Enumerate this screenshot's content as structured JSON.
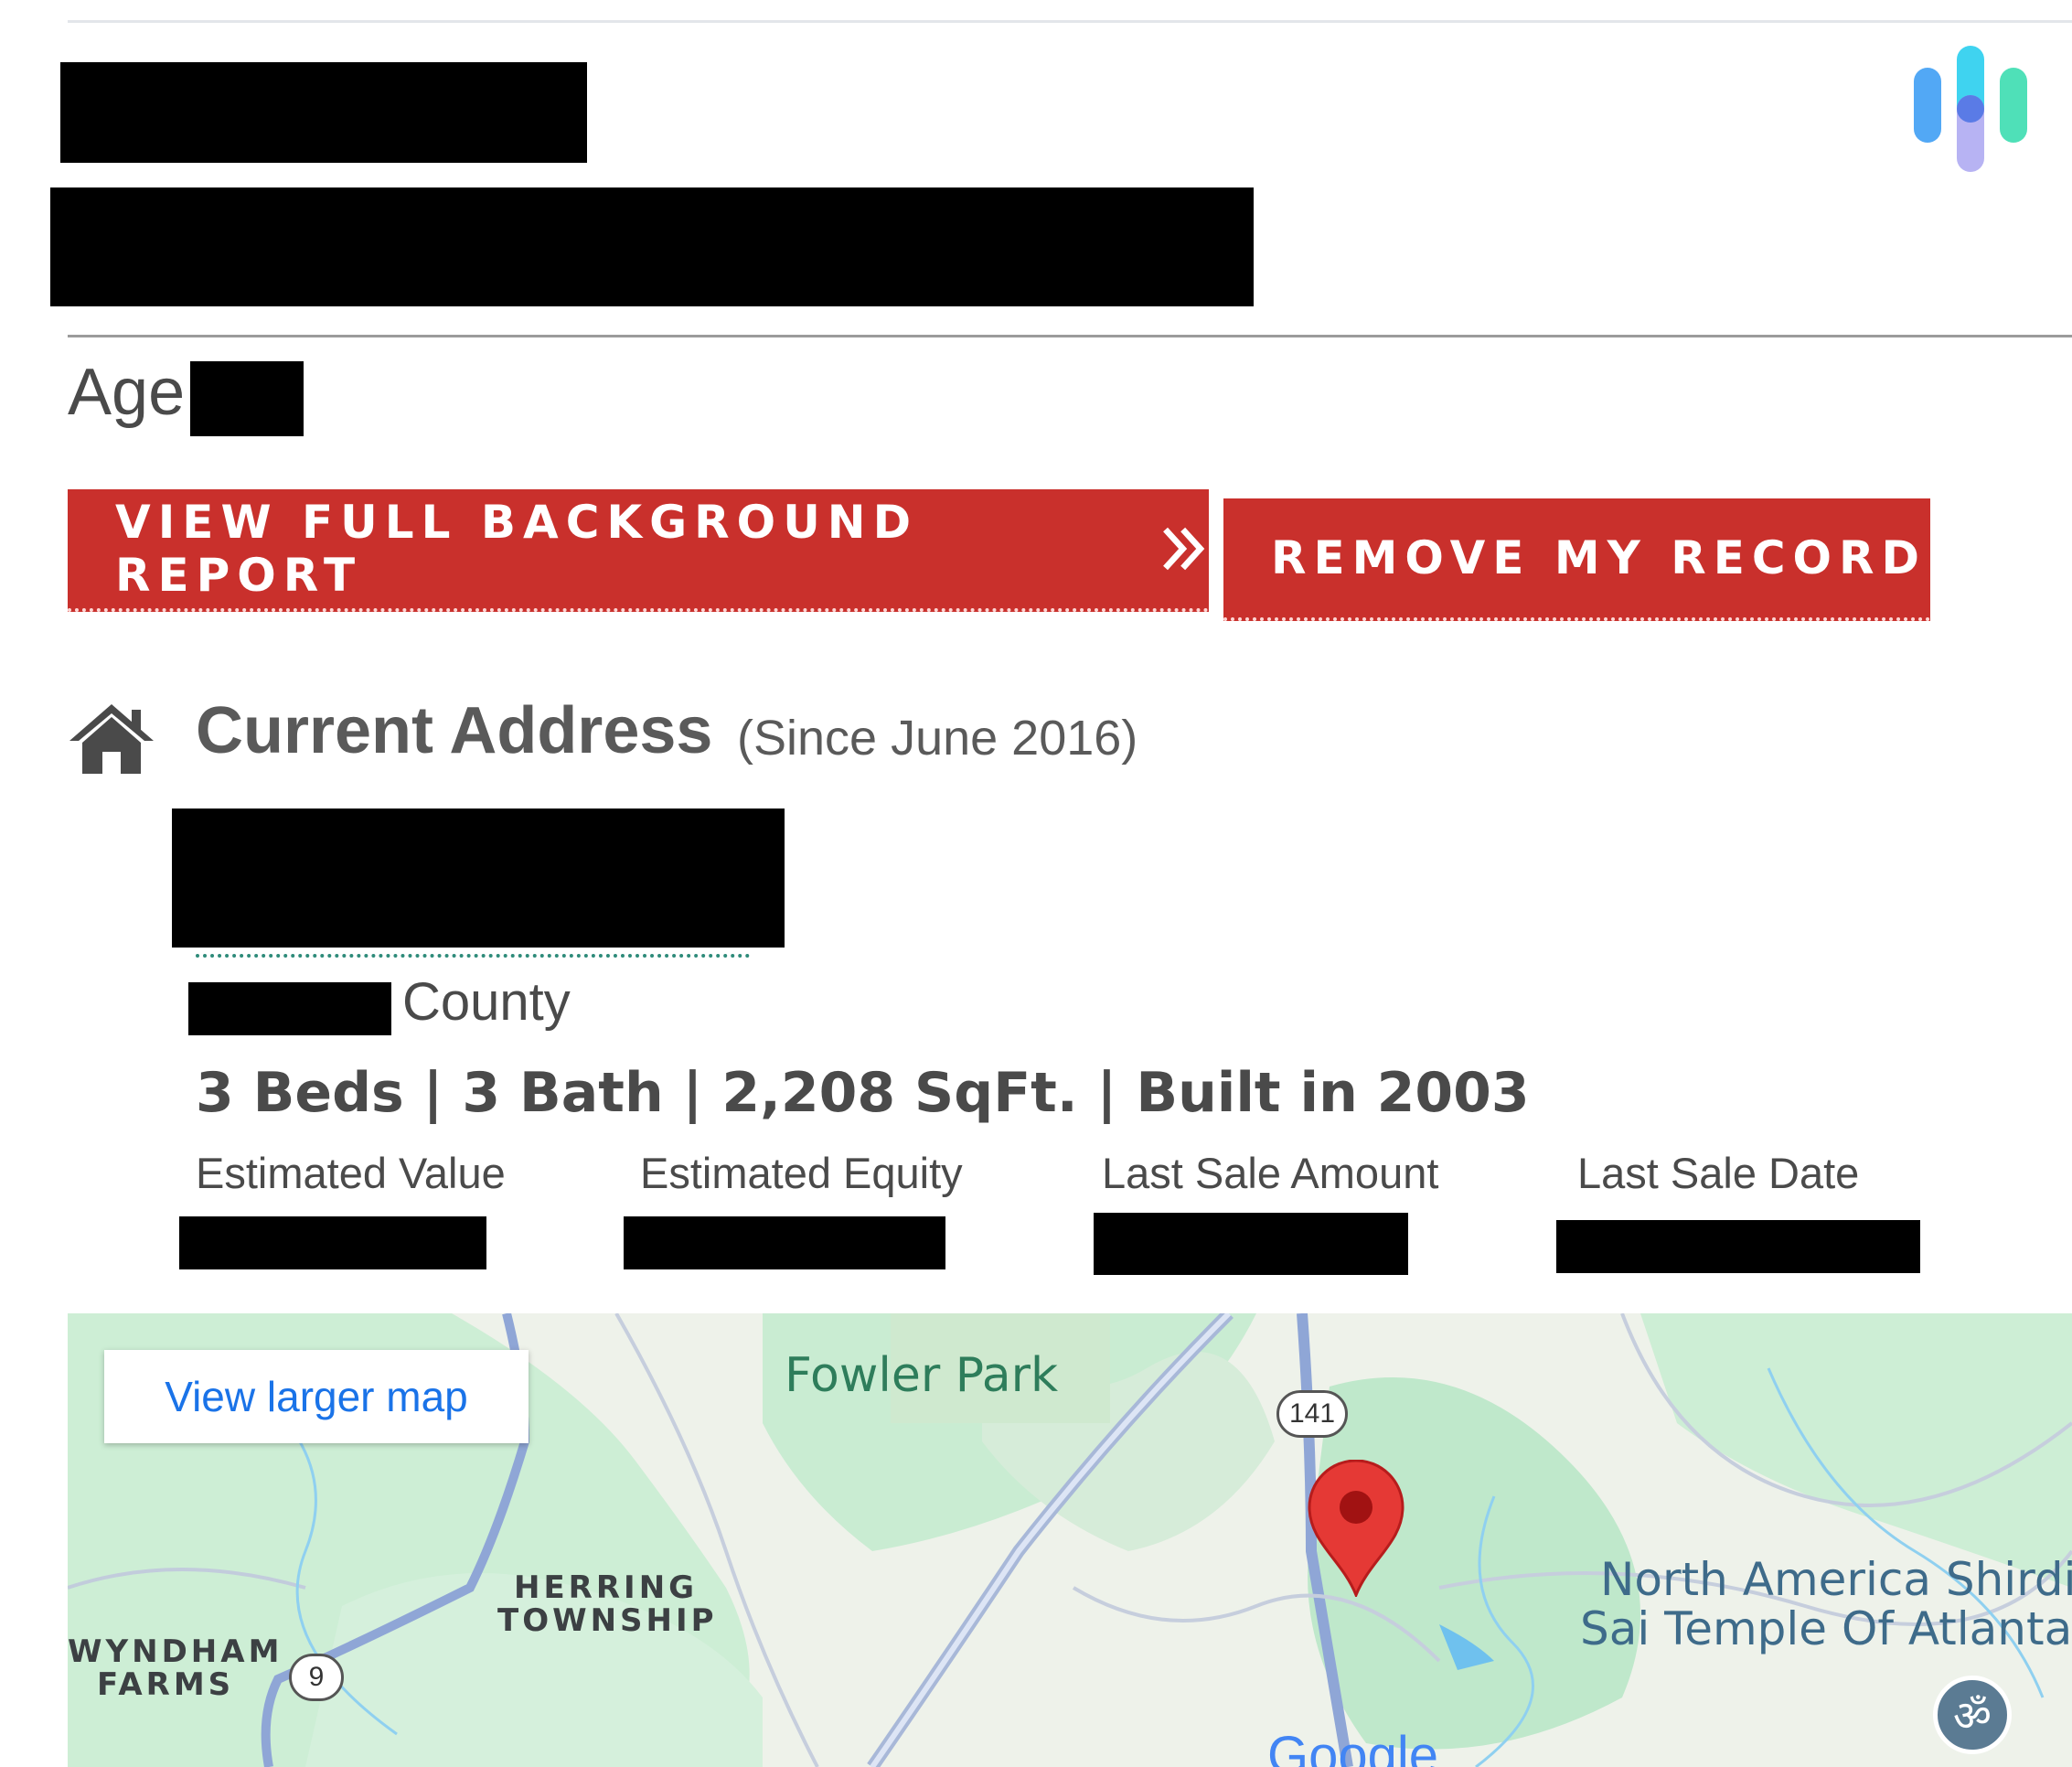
{
  "header": {
    "age_label": "Age"
  },
  "buttons": {
    "view_report_label": "VIEW FULL BACKGROUND REPORT",
    "view_report_icon": "double-chevron-right-icon",
    "remove_record_label": "REMOVE MY RECORD"
  },
  "address": {
    "icon": "home-icon",
    "title": "Current Address",
    "since": "(Since June 2016)",
    "county_suffix": "County",
    "details": "3 Beds | 3 Bath | 2,208 SqFt. | Built in 2003"
  },
  "stats": [
    {
      "label": "Estimated Value"
    },
    {
      "label": "Estimated Equity"
    },
    {
      "label": "Last Sale Amount"
    },
    {
      "label": "Last Sale Date"
    }
  ],
  "map": {
    "view_larger": "View larger map",
    "places": {
      "fowler_park": "Fowler Park",
      "herring_line1": "HERRING",
      "herring_line2": "TOWNSHIP",
      "wyndham_line1": "WYNDHAM",
      "wyndham_line2": "FARMS",
      "temple_line1": "North America Shirdi",
      "temple_line2": "Sai Temple Of Atlanta"
    },
    "routes": {
      "r141": "141",
      "r9": "9"
    },
    "attribution": "Google"
  },
  "colors": {
    "button_red": "#c9302c",
    "map_green": "#c8ecd0",
    "park_text": "#2e7d5b",
    "pin_red": "#e53935",
    "link_blue": "#1a73e8"
  }
}
